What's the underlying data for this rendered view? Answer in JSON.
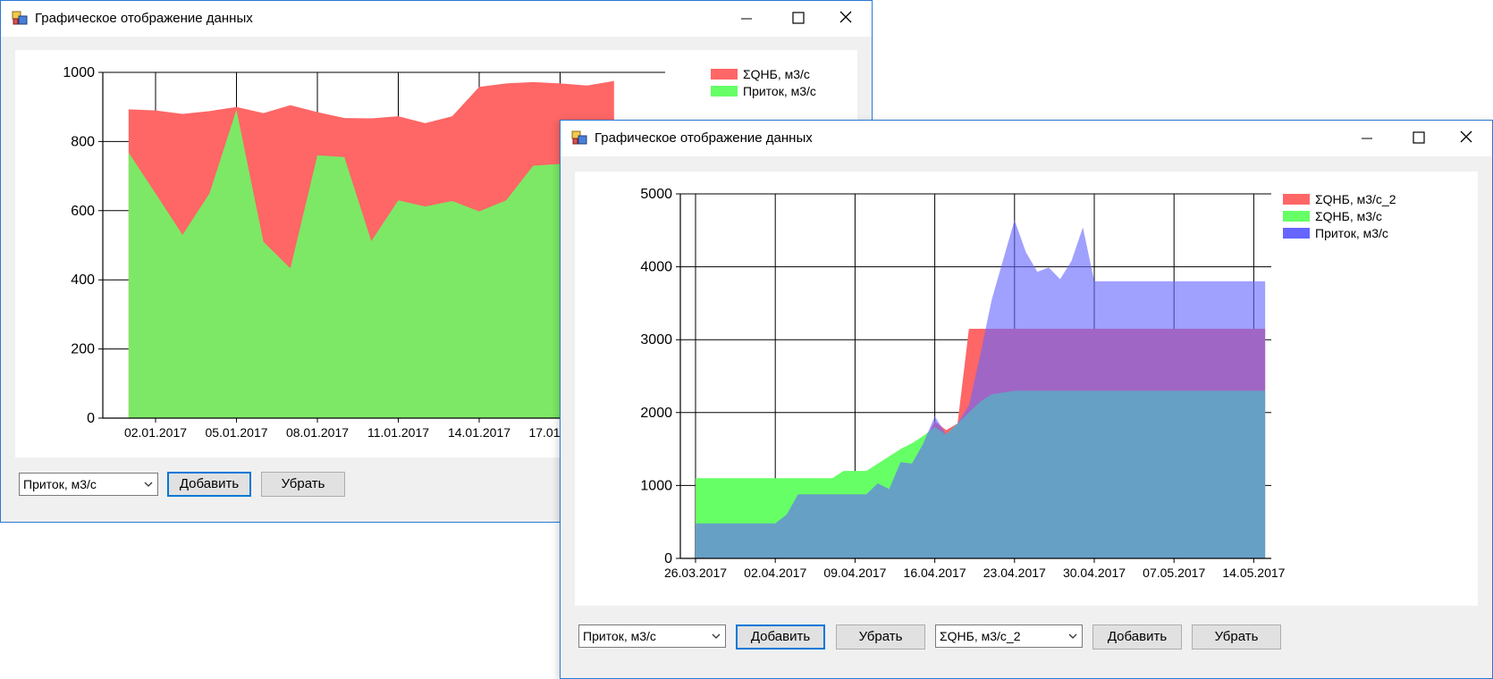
{
  "colors": {
    "red": "#ff6666",
    "green": "#66ff66",
    "green_overlap": "#6bc12f",
    "blue": "#6666ff",
    "blue_over_green": "#2a449b",
    "red_blue_overlap": "#6627c5",
    "window_border": "#2b79d3",
    "button_focus": "#0078d7"
  },
  "window1": {
    "title": "Графическое отображение данных",
    "icons": {
      "app": "app-icon",
      "minimize": "minimize-icon",
      "maximize": "maximize-icon",
      "close": "close-icon"
    },
    "controls": {
      "series_select": "Приток, м3/с",
      "add_label": "Добавить",
      "remove_label": "Убрать"
    }
  },
  "window2": {
    "title": "Графическое отображение данных",
    "icons": {
      "app": "app-icon",
      "minimize": "minimize-icon",
      "maximize": "maximize-icon",
      "close": "close-icon"
    },
    "controls": {
      "series_select_1": "Приток, м3/с",
      "add_label_1": "Добавить",
      "remove_label_1": "Убрать",
      "series_select_2": "ΣQНБ, м3/с_2",
      "add_label_2": "Добавить",
      "remove_label_2": "Убрать"
    }
  },
  "chart_data": [
    {
      "type": "area",
      "window": "window1",
      "ylim": [
        0,
        1000
      ],
      "yticks": [
        0,
        200,
        400,
        600,
        800,
        1000
      ],
      "x_tick_labels": [
        "02.01.2017",
        "05.01.2017",
        "08.01.2017",
        "11.01.2017",
        "14.01.2017",
        "17.01.2017"
      ],
      "grid": true,
      "legend_position": "top-right",
      "dates": [
        "01.01.2017",
        "02.01.2017",
        "03.01.2017",
        "04.01.2017",
        "05.01.2017",
        "06.01.2017",
        "07.01.2017",
        "08.01.2017",
        "09.01.2017",
        "10.01.2017",
        "11.01.2017",
        "12.01.2017",
        "13.01.2017",
        "14.01.2017",
        "15.01.2017",
        "16.01.2017",
        "17.01.2017",
        "18.01.2017",
        "19.01.2017"
      ],
      "series": [
        {
          "name": "ΣQНБ, м3/с",
          "color_key": "red",
          "values": [
            893,
            890,
            880,
            888,
            900,
            882,
            905,
            885,
            868,
            867,
            873,
            853,
            873,
            958,
            968,
            972,
            968,
            962,
            975
          ]
        },
        {
          "name": "Приток, м3/с",
          "color_key": "green",
          "values": [
            768,
            650,
            530,
            650,
            892,
            510,
            433,
            760,
            755,
            512,
            630,
            612,
            628,
            598,
            630,
            730,
            735,
            740,
            745
          ]
        }
      ]
    },
    {
      "type": "area",
      "window": "window2",
      "ylim": [
        0,
        5000
      ],
      "yticks": [
        0,
        1000,
        2000,
        3000,
        4000,
        5000
      ],
      "x_tick_labels": [
        "26.03.2017",
        "02.04.2017",
        "09.04.2017",
        "16.04.2017",
        "23.04.2017",
        "30.04.2017",
        "07.05.2017",
        "14.05.2017"
      ],
      "grid": true,
      "legend_position": "top-right",
      "dates": [
        "26.03.2017",
        "02.04.2017",
        "03.04.2017",
        "04.04.2017",
        "07.04.2017",
        "08.04.2017",
        "10.04.2017",
        "11.04.2017",
        "12.04.2017",
        "13.04.2017",
        "14.04.2017",
        "15.04.2017",
        "16.04.2017",
        "17.04.2017",
        "18.04.2017",
        "19.04.2017",
        "20.04.2017",
        "21.04.2017",
        "23.04.2017",
        "24.04.2017",
        "25.04.2017",
        "26.04.2017",
        "27.04.2017",
        "28.04.2017",
        "29.04.2017",
        "30.04.2017",
        "15.05.2017"
      ],
      "series": [
        {
          "name": "ΣQНБ, м3/с_2",
          "color_key": "red",
          "values": [
            480,
            480,
            600,
            880,
            880,
            880,
            880,
            1030,
            950,
            1320,
            1300,
            1580,
            1880,
            1760,
            1850,
            3150,
            3150,
            3150,
            3150,
            3150,
            3150,
            3150,
            3150,
            3150,
            3150,
            3150,
            3150
          ]
        },
        {
          "name": "ΣQНБ, м3/с",
          "color_key": "green",
          "values": [
            1100,
            1100,
            1100,
            1100,
            1100,
            1200,
            1200,
            1300,
            1400,
            1500,
            1580,
            1680,
            1800,
            1700,
            1850,
            2000,
            2150,
            2250,
            2300,
            2300,
            2300,
            2300,
            2300,
            2300,
            2300,
            2300,
            2300
          ]
        },
        {
          "name": "Приток, м3/с",
          "color_key": "blue",
          "values": [
            480,
            480,
            600,
            880,
            880,
            880,
            880,
            1030,
            950,
            1320,
            1300,
            1580,
            1950,
            1700,
            1850,
            2100,
            2800,
            3550,
            4640,
            4200,
            3930,
            3990,
            3830,
            4080,
            4540,
            3800,
            3800
          ]
        }
      ]
    }
  ]
}
